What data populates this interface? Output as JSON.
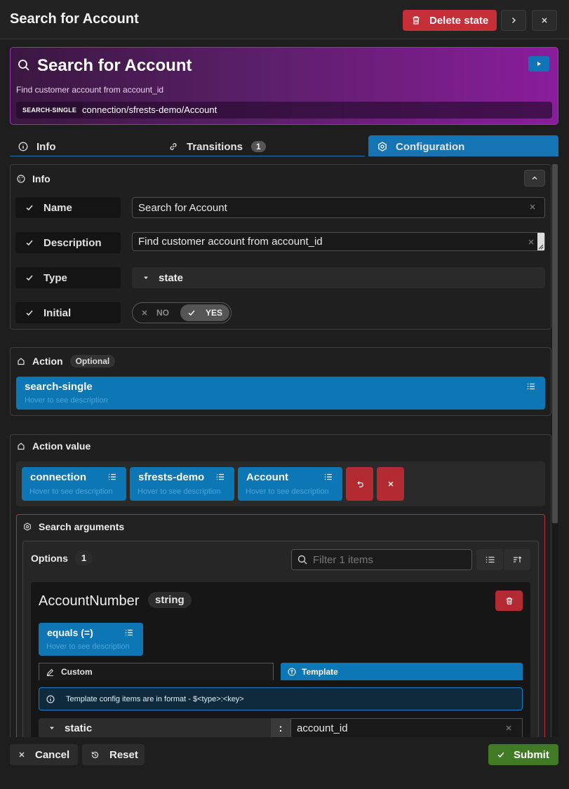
{
  "header": {
    "title": "Search for Account",
    "delete_label": "Delete state"
  },
  "card": {
    "title": "Search for Account",
    "description": "Find customer account from account_id",
    "badge": "SEARCH-SINGLE",
    "path": "connection/sfrests-demo/Account",
    "accent": "#8a1d9b"
  },
  "tabs": [
    {
      "label": "Info"
    },
    {
      "label": "Transitions",
      "count": "1"
    },
    {
      "label": "Configuration",
      "active": true
    }
  ],
  "info": {
    "title": "Info",
    "name_label": "Name",
    "name_value": "Search for Account",
    "desc_label": "Description",
    "desc_value": "Find customer account from account_id",
    "type_label": "Type",
    "type_value": "state",
    "initial_label": "Initial",
    "toggle_no": "NO",
    "toggle_yes": "YES"
  },
  "action": {
    "title": "Action",
    "optional": "Optional",
    "chip": "search-single",
    "hint": "Hover to see description"
  },
  "action_value": {
    "title": "Action value",
    "chips": [
      {
        "label": "connection",
        "hint": "Hover to see description"
      },
      {
        "label": "sfrests-demo",
        "hint": "Hover to see description"
      },
      {
        "label": "Account",
        "hint": "Hover to see description"
      }
    ]
  },
  "search_args": {
    "title": "Search arguments",
    "options_label": "Options",
    "options_count": "1",
    "filter_placeholder": "Filter 1 items",
    "item": {
      "name": "AccountNumber",
      "type": "string",
      "op": "equals (=)",
      "op_hint": "Hover to see description",
      "mode_custom": "Custom",
      "mode_template": "Template",
      "info_text": "Template config items are in format - $<type>:<key>",
      "static_label": "static",
      "colon": ":",
      "value": "account_id"
    }
  },
  "footer": {
    "cancel": "Cancel",
    "reset": "Reset",
    "submit": "Submit"
  },
  "colors": {
    "primary": "#1574b4",
    "danger": "#c62f38",
    "success": "#417a25"
  }
}
